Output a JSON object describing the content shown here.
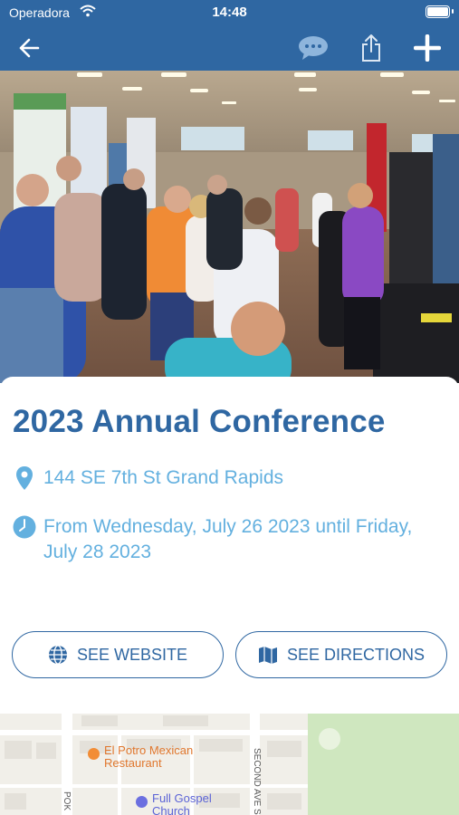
{
  "status_bar": {
    "carrier": "Operadora",
    "time": "14:48"
  },
  "nav": {
    "back_icon": "arrow-left-icon",
    "chat_icon": "speech-bubble-icon",
    "share_icon": "share-icon",
    "add_icon": "plus-icon",
    "bar_color": "#2f67a2"
  },
  "hero": {
    "subject": "conference-exhibit-hall-photo"
  },
  "event": {
    "title": "2023 Annual Conference",
    "address": "144 SE 7th St Grand Rapids",
    "dates": "From Wednesday, July 26 2023 until Friday, July 28 2023",
    "location_icon": "map-pin-icon",
    "clock_icon": "clock-icon"
  },
  "actions": {
    "website_label": "SEE WEBSITE",
    "website_icon": "globe-icon",
    "directions_label": "SEE DIRECTIONS",
    "directions_icon": "map-icon"
  },
  "map": {
    "poi_restaurant": "El Potro Mexican Restaurant",
    "poi_church": "Full Gospel Church",
    "street_second_ave": "SECOND AVE S",
    "street_pok": "POK"
  },
  "colors": {
    "accent": "#2f67a2",
    "link_text": "#63b0df"
  }
}
